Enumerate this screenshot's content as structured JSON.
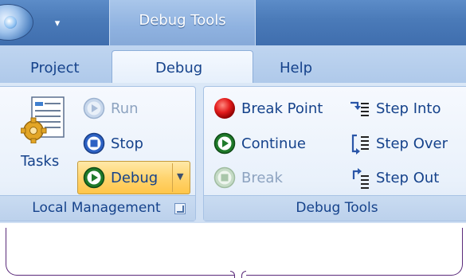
{
  "window": {
    "quick_access_glyph": "▾",
    "context_title": "Debug Tools"
  },
  "tabs": [
    {
      "label": "Project",
      "active": false
    },
    {
      "label": "Debug",
      "active": true
    },
    {
      "label": "Help",
      "active": false
    }
  ],
  "groups": {
    "local_management": {
      "caption": "Local Management",
      "tasks_label": "Tasks",
      "run_label": "Run",
      "stop_label": "Stop",
      "debug_label": "Debug"
    },
    "debug_tools": {
      "caption": "Debug Tools",
      "break_point_label": "Break Point",
      "continue_label": "Continue",
      "break_label": "Break",
      "step_into_label": "Step Into",
      "step_over_label": "Step Over",
      "step_out_label": "Step Out"
    }
  },
  "colors": {
    "accent": "#15428b",
    "disabled_text": "#8da3c0",
    "highlight": "#ffd46f"
  }
}
